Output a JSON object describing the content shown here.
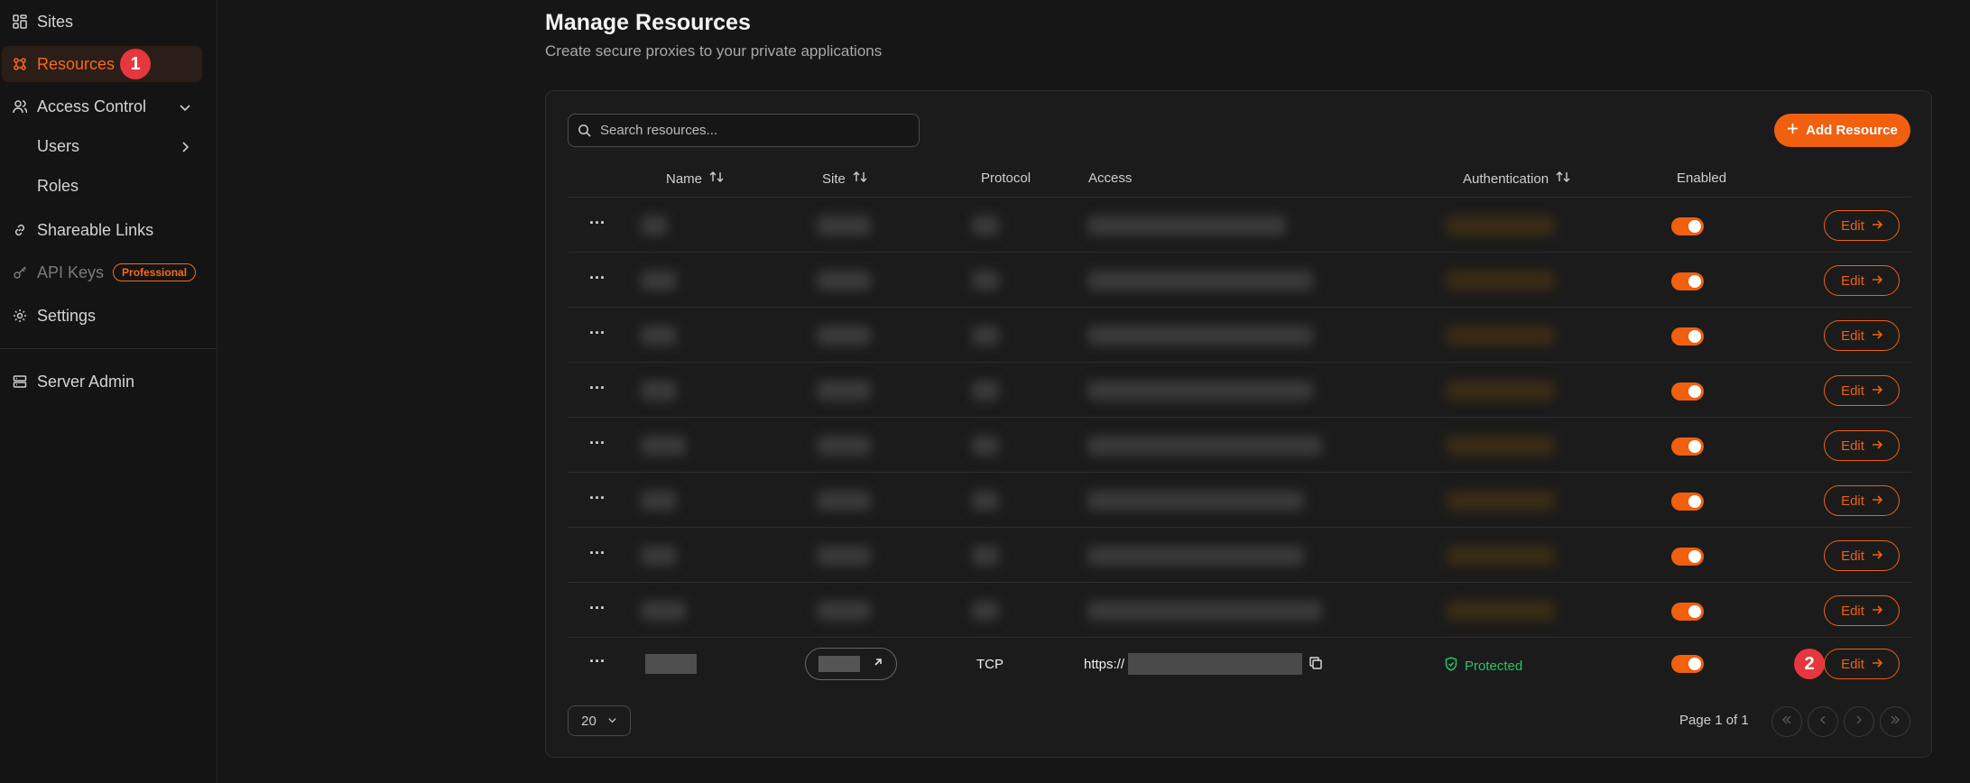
{
  "sidebar": {
    "items": [
      {
        "label": "Sites",
        "icon": "sites-icon"
      },
      {
        "label": "Resources",
        "icon": "resources-icon",
        "active": true,
        "annotation": "1"
      },
      {
        "label": "Access Control",
        "icon": "users-icon"
      },
      {
        "label": "Users"
      },
      {
        "label": "Roles"
      },
      {
        "label": "Shareable Links",
        "icon": "link-icon"
      },
      {
        "label": "API Keys",
        "icon": "key-icon",
        "badge": "Professional"
      },
      {
        "label": "Settings",
        "icon": "gear-icon"
      },
      {
        "label": "Server Admin",
        "icon": "server-icon"
      }
    ]
  },
  "header": {
    "title": "Manage Resources",
    "subtitle": "Create secure proxies to your private applications"
  },
  "toolbar": {
    "search_placeholder": "Search resources...",
    "add_label": "Add Resource"
  },
  "table": {
    "columns": {
      "name": "Name",
      "site": "Site",
      "protocol": "Protocol",
      "access": "Access",
      "authentication": "Authentication",
      "enabled": "Enabled"
    },
    "edit_label": "Edit",
    "more_label": "···",
    "last_row": {
      "protocol": "TCP",
      "access_prefix": "https://",
      "auth_status": "Protected",
      "annotation": "2"
    }
  },
  "pagination": {
    "page_size": "20",
    "page_info": "Page 1 of 1"
  },
  "colors": {
    "accent": "#f0600f",
    "annotation": "#e5373d",
    "success": "#25c46a"
  }
}
